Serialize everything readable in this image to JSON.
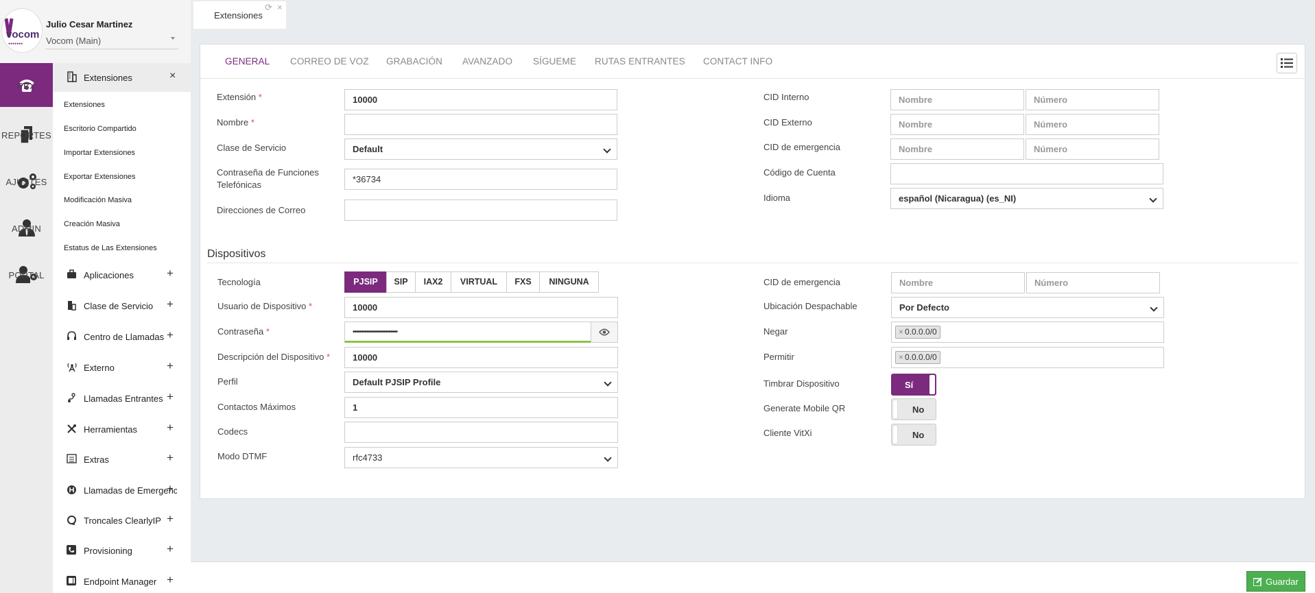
{
  "user": {
    "name": "Julio Cesar Martinez",
    "tenant": "Vocom (Main)",
    "logo_text": "vocom"
  },
  "rail": [
    {
      "label": "PBX",
      "icon": "phone-icon",
      "active": true
    },
    {
      "label": "REPORTES",
      "icon": "documents-icon"
    },
    {
      "label": "AJUSTES",
      "icon": "gears-icon"
    },
    {
      "label": "ADMIN",
      "icon": "admin-user-icon"
    },
    {
      "label": "PORTAL",
      "icon": "user-gear-icon"
    }
  ],
  "submenu": {
    "title": "Extensiones",
    "close": "×",
    "links": [
      "Extensiones",
      "Escritorio Compartido",
      "Importar Extensiones",
      "Exportar Extensiones",
      "Modificación Masiva",
      "Creación Masiva",
      "Estatus de Las Extensiones"
    ],
    "sections": [
      "Aplicaciones",
      "Clase de Servicio",
      "Centro de Llamadas",
      "Externo",
      "Llamadas Entrantes",
      "Herramientas",
      "Extras",
      "Llamadas de Emergencia",
      "Troncales ClearlyIP",
      "Provisioning",
      "Endpoint Manager"
    ],
    "plus": "+"
  },
  "page_tab": {
    "label": "Extensiones",
    "refresh": "⟳",
    "close": "×"
  },
  "tabs": [
    "GENERAL",
    "CORREO DE VOZ",
    "GRABACIÓN",
    "AVANZADO",
    "SÍGUEME",
    "RUTAS ENTRANTES",
    "CONTACT INFO"
  ],
  "general": {
    "extension_label": "Extensión",
    "extension_value": "10000",
    "nombre_label": "Nombre",
    "nombre_value": "",
    "cos_label": "Clase de Servicio",
    "cos_value": "Default",
    "fc_pass_label_1": "Contraseña de Funciones",
    "fc_pass_label_2": "Telefónicas",
    "fc_pass_value": "*36734",
    "email_label": "Direcciones de Correo",
    "email_value": "",
    "cid_interno_label": "CID Interno",
    "cid_externo_label": "CID Externo",
    "cid_emerg_label": "CID de emergencia",
    "nombre_ph": "Nombre",
    "numero_ph": "Número",
    "cuenta_label": "Código de Cuenta",
    "cuenta_value": "",
    "idioma_label": "Idioma",
    "idioma_value": "español (Nicaragua) (es_NI)",
    "required_mark": "*"
  },
  "devices": {
    "title": "Dispositivos",
    "tech_label": "Tecnología",
    "tech_options": [
      "PJSIP",
      "SIP",
      "IAX2",
      "VIRTUAL",
      "FXS",
      "NINGUNA"
    ],
    "tech_selected": "PJSIP",
    "user_label": "Usuario de Dispositivo",
    "user_value": "10000",
    "pass_label": "Contraseña",
    "pass_value": "••••••••••••••••••••••••••",
    "desc_label": "Descripción del Dispositivo",
    "desc_value": "10000",
    "profile_label": "Perfil",
    "profile_value": "Default PJSIP Profile",
    "max_contacts_label": "Contactos Máximos",
    "max_contacts_value": "1",
    "codecs_label": "Codecs",
    "codecs_value": "",
    "dtmf_label": "Modo DTMF",
    "dtmf_value": "rfc4733",
    "cid_emerg_label": "CID de emergencia",
    "ubicacion_label": "Ubicación Despachable",
    "ubicacion_value": "Por Defecto",
    "negar_label": "Negar",
    "negar_tag": "0.0.0.0/0",
    "permitir_label": "Permitir",
    "permitir_tag": "0.0.0.0/0",
    "tag_remove": "×",
    "timbrar_label": "Timbrar Dispositivo",
    "timbrar_value": "Sí",
    "qr_label": "Generate Mobile QR",
    "qr_value": "No",
    "vitxi_label": "Cliente VitXi",
    "vitxi_value": "No"
  },
  "footer": {
    "save_label": "Guardar"
  },
  "colors": {
    "accent": "#7b2a7e",
    "save": "#4caf50",
    "password_strength": "#8bc34a"
  }
}
